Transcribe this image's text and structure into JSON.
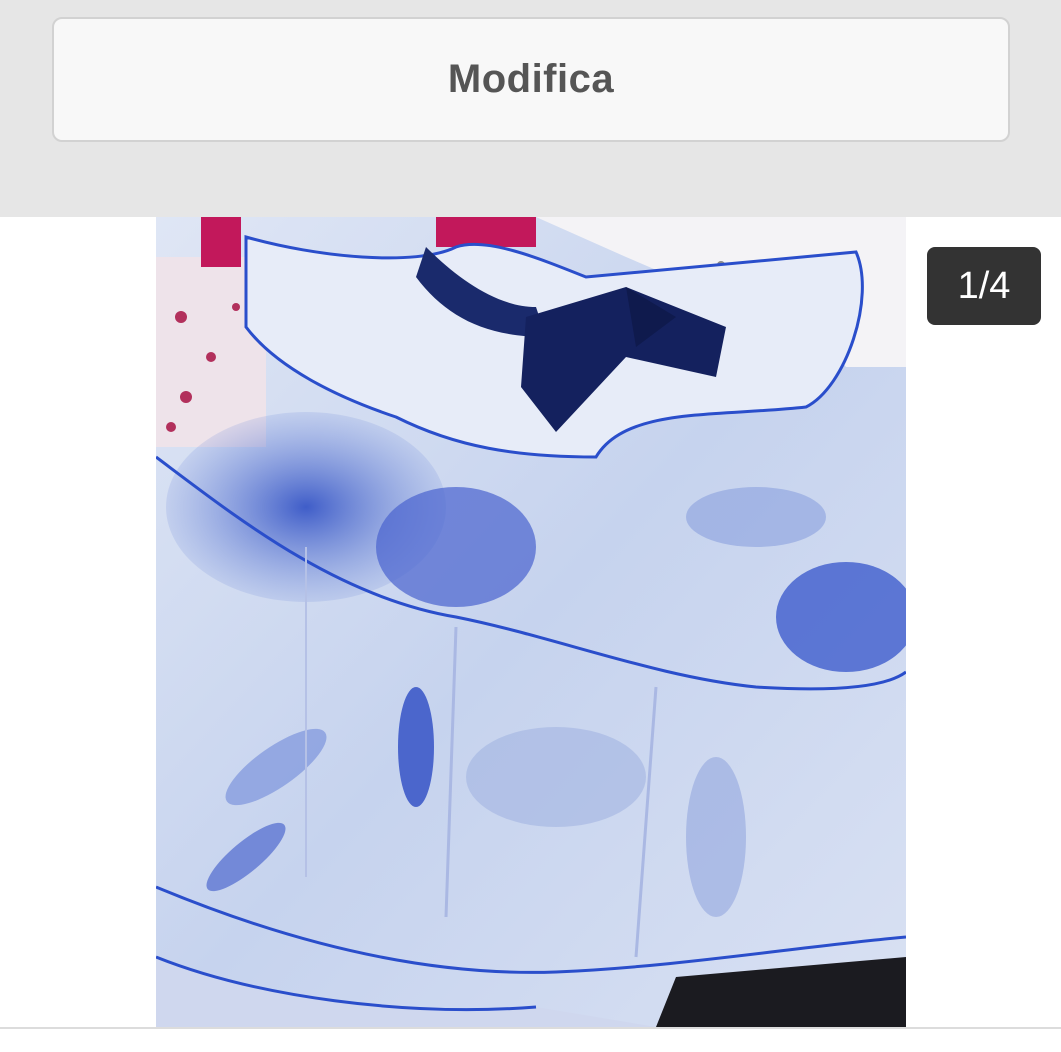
{
  "header": {
    "edit_label": "Modifica"
  },
  "gallery": {
    "counter": "1/4",
    "current_index": 1,
    "total": 4,
    "image_subject": "blue-white-ruffled-baby-dress"
  },
  "colors": {
    "header_bg": "#e6e6e6",
    "button_bg": "#f8f8f8",
    "button_text": "#555555",
    "counter_bg": "#333333",
    "counter_text": "#ffffff"
  }
}
